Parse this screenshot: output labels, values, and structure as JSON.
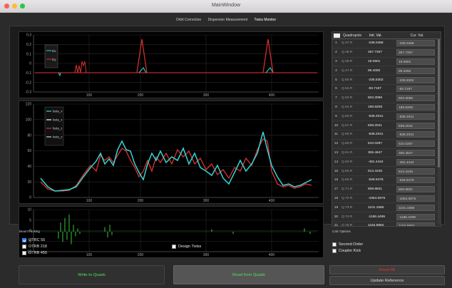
{
  "window": {
    "title": "MainWindow"
  },
  "tabs": [
    {
      "label": "Orbit Correction"
    },
    {
      "label": "Dispersion Measurement"
    },
    {
      "label": "Twiss Monitor"
    }
  ],
  "plot_top": {
    "yticks": [
      "0.3",
      "0.2",
      "0.1",
      "0",
      "-0.1",
      "-0.2",
      "-0.3"
    ],
    "xticks": [
      "100",
      "200",
      "300",
      "400"
    ],
    "legend": [
      "Dx",
      "Dy"
    ],
    "colors": {
      "Dx": "#33d6d6",
      "Dy": "#e03030"
    }
  },
  "plot_mid": {
    "yticks": [
      "120",
      "100",
      "80",
      "60",
      "40",
      "20",
      "0"
    ],
    "xticks": [
      "100",
      "200",
      "300",
      "400"
    ],
    "legend": [
      "beta_x",
      "beta_x",
      "beta_z",
      "beta_z"
    ],
    "colors": {
      "a": "#33d6d6",
      "b": "#ffffff",
      "c": "#e03030",
      "d": "#d0d0d0"
    }
  },
  "plot_bot": {
    "yticks": [
      "10",
      "5",
      "0",
      "-5",
      "-10"
    ],
    "xticks": [
      "100",
      "200",
      "300",
      "400"
    ]
  },
  "table": {
    "headers": [
      "",
      "Quadrupole",
      "Init. Val.",
      "Cur. Val."
    ],
    "rows": [
      {
        "n": "1",
        "quad": "Q.37.R",
        "init": "-238.0468",
        "cur": "-238.0468"
      },
      {
        "n": "2",
        "quad": "Q.38.R",
        "init": "267.7267",
        "cur": "267.7267"
      },
      {
        "n": "3",
        "quad": "Q.39.R",
        "init": "19.0601",
        "cur": "19.0601"
      },
      {
        "n": "4",
        "quad": "Q.47.R",
        "init": "89.4092",
        "cur": "89.4092"
      },
      {
        "n": "5",
        "quad": "Q.50.R",
        "init": "-235.5302",
        "cur": "-235.5302"
      },
      {
        "n": "6",
        "quad": "Q.53.R",
        "init": "-83.7197",
        "cur": "-83.7197"
      },
      {
        "n": "7",
        "quad": "Q.53.R",
        "init": "503.3096",
        "cur": "503.3096"
      },
      {
        "n": "8",
        "quad": "Q.54.R",
        "init": "188.8208",
        "cur": "188.8208"
      },
      {
        "n": "9",
        "quad": "Q.55.R",
        "init": "-838.2041",
        "cur": "-838.2041"
      },
      {
        "n": "10",
        "quad": "Q.57.R",
        "init": "838.2041",
        "cur": "838.2041"
      },
      {
        "n": "11",
        "quad": "Q.58.R",
        "init": "-838.2041",
        "cur": "-838.2041"
      },
      {
        "n": "12",
        "quad": "Q.60.R",
        "init": "510.0287",
        "cur": "510.0287"
      },
      {
        "n": "13",
        "quad": "Q.61.R",
        "init": "306.4647",
        "cur": "306.4647"
      },
      {
        "n": "14",
        "quad": "Q.63.R",
        "init": "-481.4444",
        "cur": "-481.4444"
      },
      {
        "n": "15",
        "quad": "Q.65.R",
        "init": "513.4445",
        "cur": "513.4445"
      },
      {
        "n": "16",
        "quad": "Q.66.R",
        "init": "-528.8478",
        "cur": "-528.8478"
      },
      {
        "n": "17",
        "quad": "Q.71.R",
        "init": "808.9831",
        "cur": "808.9831"
      },
      {
        "n": "18",
        "quad": "Q.72.R",
        "init": "-1054.0875",
        "cur": "-1054.0875"
      },
      {
        "n": "19",
        "quad": "Q.73.R",
        "init": "1101.1586",
        "cur": "1101.1586"
      },
      {
        "n": "20",
        "quad": "Q.74.R",
        "init": "-1186.4499",
        "cur": "-1186.4499"
      },
      {
        "n": "21",
        "quad": "Q.75.R",
        "init": "1184.9884",
        "cur": "1184.9884"
      },
      {
        "n": "22",
        "quad": "Q.77.R",
        "init": "-1186.4499",
        "cur": "-1186.4499"
      }
    ]
  },
  "orbit_tracking": {
    "label": "BeamTracking",
    "options": [
      {
        "label": "OTRC 55",
        "checked": true
      },
      {
        "label": "OTRB 218",
        "checked": false
      },
      {
        "label": "OTRB 450",
        "checked": false
      }
    ]
  },
  "design_twiss": {
    "label": "Design Twiss",
    "checked": false
  },
  "calc_options": {
    "label": "Calc Options",
    "options": [
      {
        "label": "Second Order",
        "checked": false
      },
      {
        "label": "Coupler Kick",
        "checked": false
      }
    ]
  },
  "buttons": {
    "write": "Write to Quads",
    "read": "Read from Quads",
    "reset": "Reset All",
    "update": "Update Reference"
  },
  "colors": {
    "write_text": "#55e055",
    "reset_text": "#e03030"
  }
}
